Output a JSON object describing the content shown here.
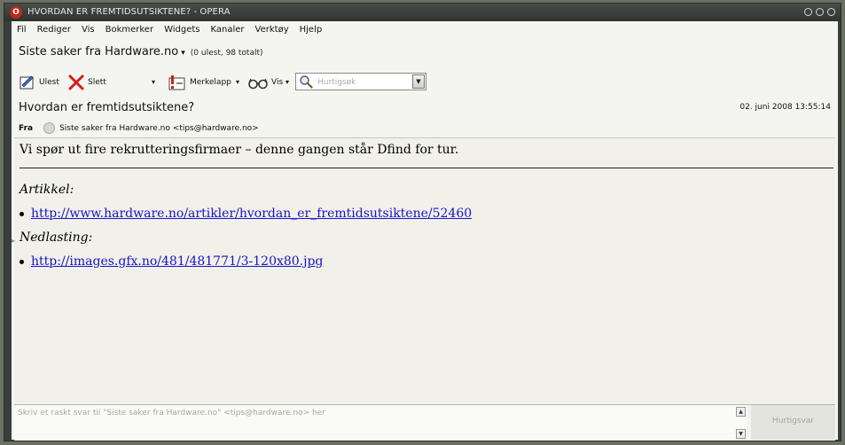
{
  "window": {
    "title": "HVORDAN ER FREMTIDSUTSIKTENE? - OPERA",
    "logo": "O"
  },
  "menu": [
    "Fil",
    "Rediger",
    "Vis",
    "Bokmerker",
    "Widgets",
    "Kanaler",
    "Verktøy",
    "Hjelp"
  ],
  "folder": {
    "name": "Siste saker fra Hardware.no",
    "arrow": "▾",
    "counts": "(0 ulest, 98 totalt)"
  },
  "toolbar": {
    "unread_label": "Ulest",
    "delete_label": "Slett",
    "label_label": "Merkelapp",
    "view_label": "Vis",
    "dropdown_glyph": "▾",
    "search_placeholder": "Hurtigsøk",
    "search_btn_glyph": "▼"
  },
  "message": {
    "subject": "Hvordan er fremtidsutsiktene?",
    "date": "02. juni 2008 13:55:14",
    "from_label": "Fra",
    "from_value": "Siste saker fra Hardware.no <tips@hardware.no>",
    "lead": "Vi spør ut fire rekrutteringsfirmaer – denne gangen står Dfind for tur.",
    "section1": "Artikkel:",
    "link1": "http://www.hardware.no/artikler/hvordan_er_fremtidsutsiktene/52460",
    "section2": "Nedlasting:",
    "link2": "http://images.gfx.no/481/481771/3-120x80.jpg"
  },
  "reply": {
    "placeholder": "Skriv et raskt svar til \"Siste saker fra Hardware.no\" <tips@hardware.no> her",
    "button": "Hurtigsvar",
    "up_glyph": "▲",
    "down_glyph": "▼"
  },
  "side_glyph": "▸"
}
